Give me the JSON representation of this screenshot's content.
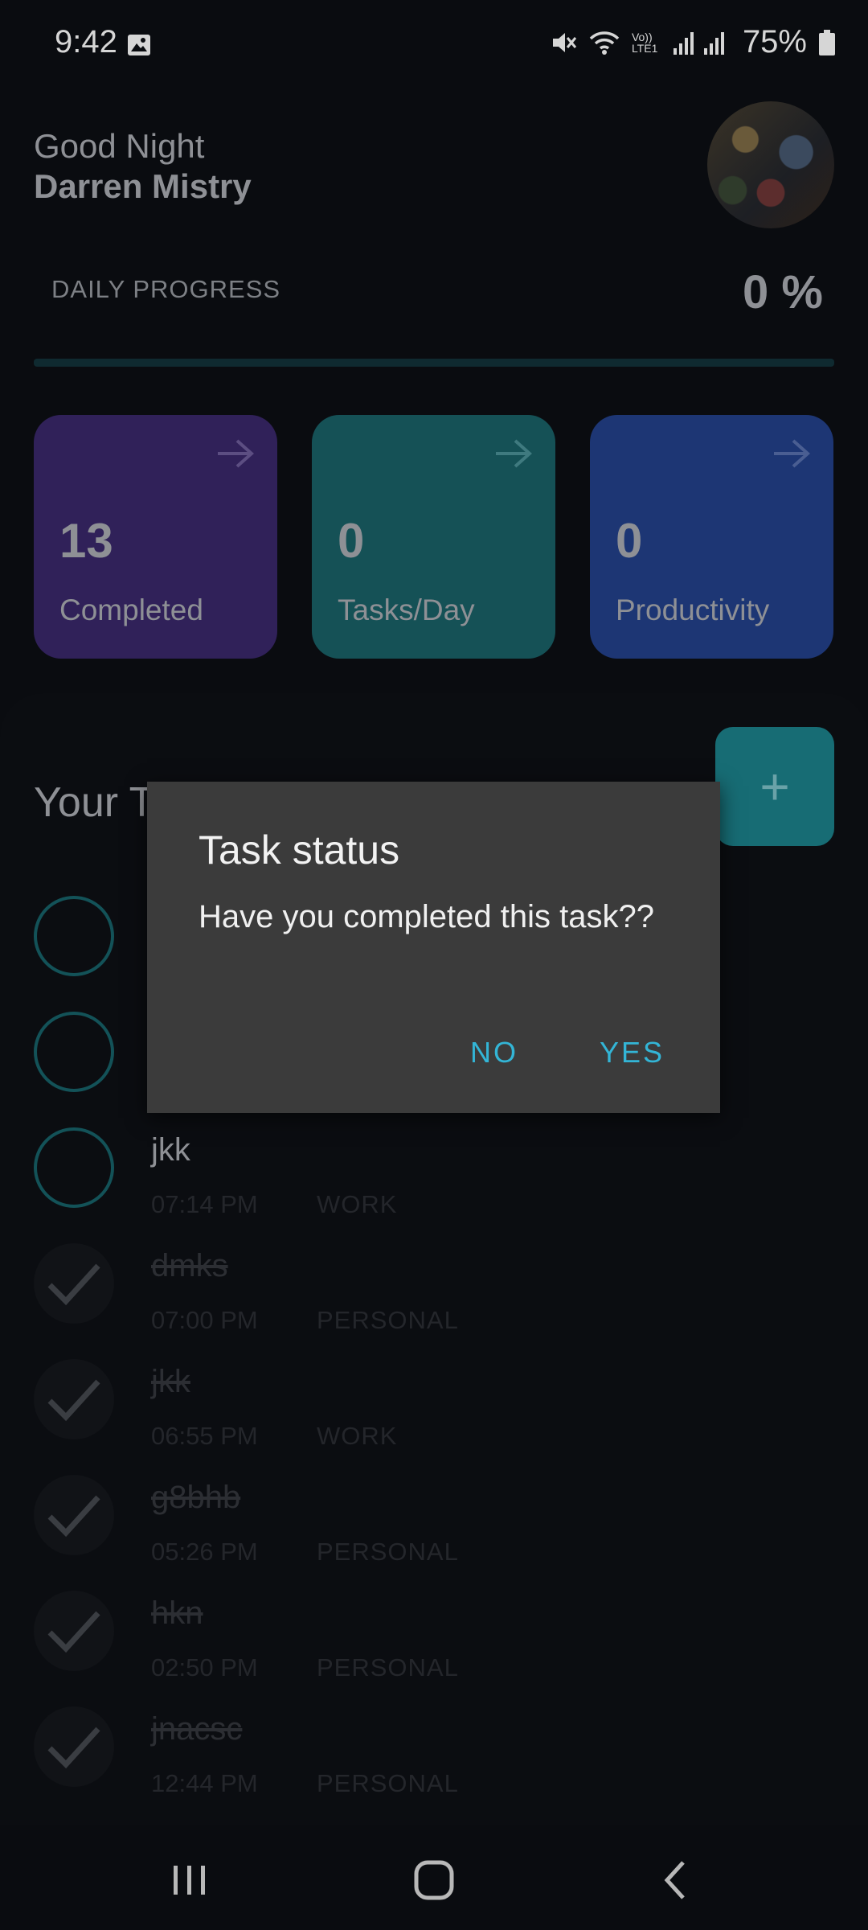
{
  "status_bar": {
    "time": "9:42",
    "battery": "75%",
    "network_label": "Vo)) LTE1"
  },
  "header": {
    "greeting": "Good Night",
    "user_name": "Darren Mistry"
  },
  "progress": {
    "label": "DAILY PROGRESS",
    "value_text": "0 %",
    "fraction": 0.0
  },
  "stats": [
    {
      "value": "13",
      "label": "Completed",
      "color": "#302159"
    },
    {
      "value": "0",
      "label": "Tasks/Day",
      "color": "#155156"
    },
    {
      "value": "0",
      "label": "Productivity",
      "color": "#1d3674"
    }
  ],
  "tasks_section": {
    "heading": "Your T",
    "add_icon": "plus-icon"
  },
  "tasks": [
    {
      "title": "",
      "time": "",
      "category": "",
      "done": false
    },
    {
      "title": "",
      "time": "",
      "category": "",
      "done": false
    },
    {
      "title": "jkk",
      "time": "07:14 PM",
      "category": "WORK",
      "done": false
    },
    {
      "title": "dmks",
      "time": "07:00 PM",
      "category": "PERSONAL",
      "done": true
    },
    {
      "title": "jkk",
      "time": "06:55 PM",
      "category": "WORK",
      "done": true
    },
    {
      "title": "g8bhb",
      "time": "05:26 PM",
      "category": "PERSONAL",
      "done": true
    },
    {
      "title": "hkn",
      "time": "02:50 PM",
      "category": "PERSONAL",
      "done": true
    },
    {
      "title": "jnacsc",
      "time": "12:44 PM",
      "category": "PERSONAL",
      "done": true
    }
  ],
  "dialog": {
    "title": "Task status",
    "message": "Have you completed this task??",
    "no_label": "NO",
    "yes_label": "YES",
    "button_color": "#33b5d6"
  },
  "nav": {
    "recents_icon": "recents-icon",
    "home_icon": "home-icon",
    "back_icon": "back-icon"
  }
}
